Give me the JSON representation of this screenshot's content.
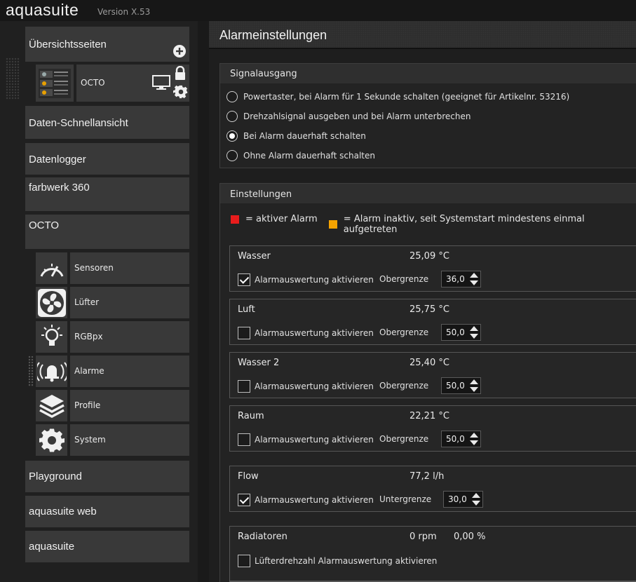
{
  "app": {
    "name": "aquasuite",
    "version": "Version X.53"
  },
  "sidebar": {
    "overview": "Übersichtsseiten",
    "overview_child": "OCTO",
    "items": [
      "Daten-Schnellansicht",
      "Datenlogger",
      "farbwerk 360",
      "OCTO"
    ],
    "octo_sub": [
      {
        "label": "Sensoren",
        "icon": "gauge-icon"
      },
      {
        "label": "Lüfter",
        "icon": "fan-icon"
      },
      {
        "label": "RGBpx",
        "icon": "lightbulb-icon"
      },
      {
        "label": "Alarme",
        "icon": "alarm-bell-icon"
      },
      {
        "label": "Profile",
        "icon": "layers-icon"
      },
      {
        "label": "System",
        "icon": "gear-icon"
      }
    ],
    "bottom_items": [
      "Playground",
      "aquasuite web",
      "aquasuite"
    ]
  },
  "main": {
    "title": "Alarmeinstellungen",
    "signal": {
      "title": "Signalausgang",
      "options": [
        "Powertaster, bei Alarm für 1 Sekunde schalten (geeignet für Artikelnr. 53216)",
        "Drehzahlsignal ausgeben und bei Alarm unterbrechen",
        "Bei Alarm dauerhaft schalten",
        "Ohne Alarm dauerhaft schalten"
      ],
      "selected_index": 2
    },
    "settings": {
      "title": "Einstellungen",
      "legend_active": "= aktiver Alarm",
      "legend_inactive": "= Alarm inaktiv, seit Systemstart mindestens einmal aufgetreten",
      "colors": {
        "active": "#e81c1c",
        "inactive": "#f5a300"
      }
    },
    "sensors": [
      {
        "name": "Wasser",
        "value": "25,09 °C",
        "checked": true,
        "check_label": "Alarmauswertung aktivieren",
        "limit_label": "Obergrenze",
        "limit": "36,0"
      },
      {
        "name": "Luft",
        "value": "25,75 °C",
        "checked": false,
        "check_label": "Alarmauswertung aktivieren",
        "limit_label": "Obergrenze",
        "limit": "50,0"
      },
      {
        "name": "Wasser 2",
        "value": "25,40 °C",
        "checked": false,
        "check_label": "Alarmauswertung aktivieren",
        "limit_label": "Obergrenze",
        "limit": "50,0"
      },
      {
        "name": "Raum",
        "value": "22,21 °C",
        "checked": false,
        "check_label": "Alarmauswertung aktivieren",
        "limit_label": "Obergrenze",
        "limit": "50,0"
      },
      {
        "name": "Flow",
        "value": "77,2 l/h",
        "checked": true,
        "check_label": "Alarmauswertung aktivieren",
        "limit_label": "Untergrenze",
        "limit": "30,0"
      }
    ],
    "fan": {
      "name": "Radiatoren",
      "rpm": "0 rpm",
      "percent": "0,00 %",
      "checked": false,
      "check_label": "Lüfterdrehzahl Alarmauswertung aktivieren"
    }
  }
}
